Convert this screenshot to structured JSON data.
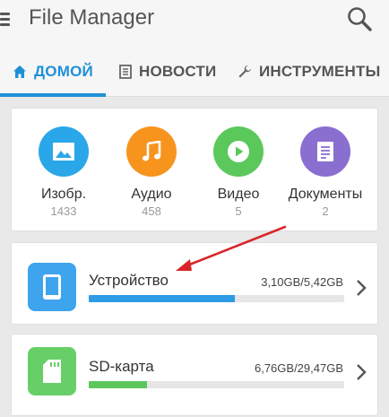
{
  "app": {
    "title": "File Manager"
  },
  "icons": {
    "menu": "hamburger-menu-icon",
    "search": "magnifier-search-icon"
  },
  "tabs": [
    {
      "label": "ДОМОЙ",
      "icon": "home-icon",
      "active": true
    },
    {
      "label": "НОВОСТИ",
      "icon": "news-icon",
      "active": false
    },
    {
      "label": "ИНСТРУМЕНТЫ",
      "icon": "wrench-icon",
      "active": false
    }
  ],
  "categories": [
    {
      "label": "Изобр.",
      "count": "1433",
      "icon": "image-icon",
      "color": "#29a7e8"
    },
    {
      "label": "Аудио",
      "count": "458",
      "icon": "music-note-icon",
      "color": "#f7941d"
    },
    {
      "label": "Видео",
      "count": "5",
      "icon": "play-icon",
      "color": "#5bc85b"
    },
    {
      "label": "Документы",
      "count": "2",
      "icon": "document-icon",
      "color": "#8a6fd0"
    }
  ],
  "storage": [
    {
      "name": "Устройство",
      "size": "3,10GB/5,42GB",
      "used_fraction": 0.572,
      "icon": "phone-device-icon",
      "color": "#3fa4ee",
      "bar_color": "#2e9be6"
    },
    {
      "name": "SD-карта",
      "size": "6,76GB/29,47GB",
      "used_fraction": 0.229,
      "icon": "sd-card-icon",
      "color": "#68cf68",
      "bar_color": "#5dc75d"
    }
  ],
  "colors": {
    "accent": "#1e90d8",
    "annotation_arrow": "#d9252a"
  }
}
